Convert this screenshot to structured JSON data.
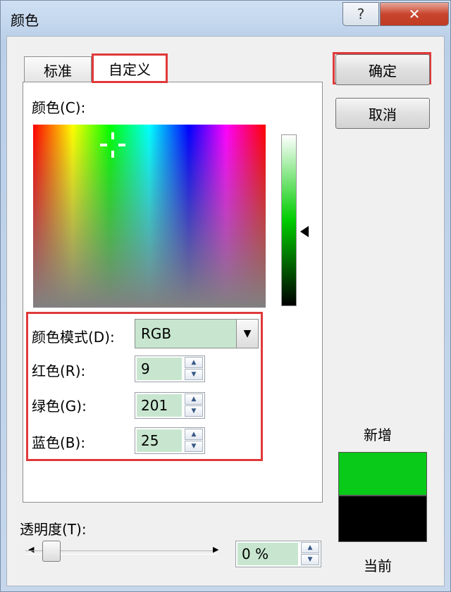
{
  "window": {
    "title": "颜色",
    "help_label": "?",
    "close_label": "✕"
  },
  "tabs": [
    {
      "label": "标准"
    },
    {
      "label": "自定义",
      "selected": true
    }
  ],
  "custom": {
    "colors_label": "颜色(C):",
    "mode_label": "颜色模式(D):",
    "mode_value": "RGB",
    "red_label": "红色(R):",
    "red_value": "9",
    "green_label": "绿色(G):",
    "green_value": "201",
    "blue_label": "蓝色(B):",
    "blue_value": "25"
  },
  "buttons": {
    "ok": "确定",
    "cancel": "取消"
  },
  "preview": {
    "new_label": "新增",
    "current_label": "当前",
    "new_color": "#09c919",
    "current_color": "#000000"
  },
  "transparency": {
    "label": "透明度(T):",
    "value": "0 %",
    "level": 0
  },
  "highlight_color": "#e0393a"
}
